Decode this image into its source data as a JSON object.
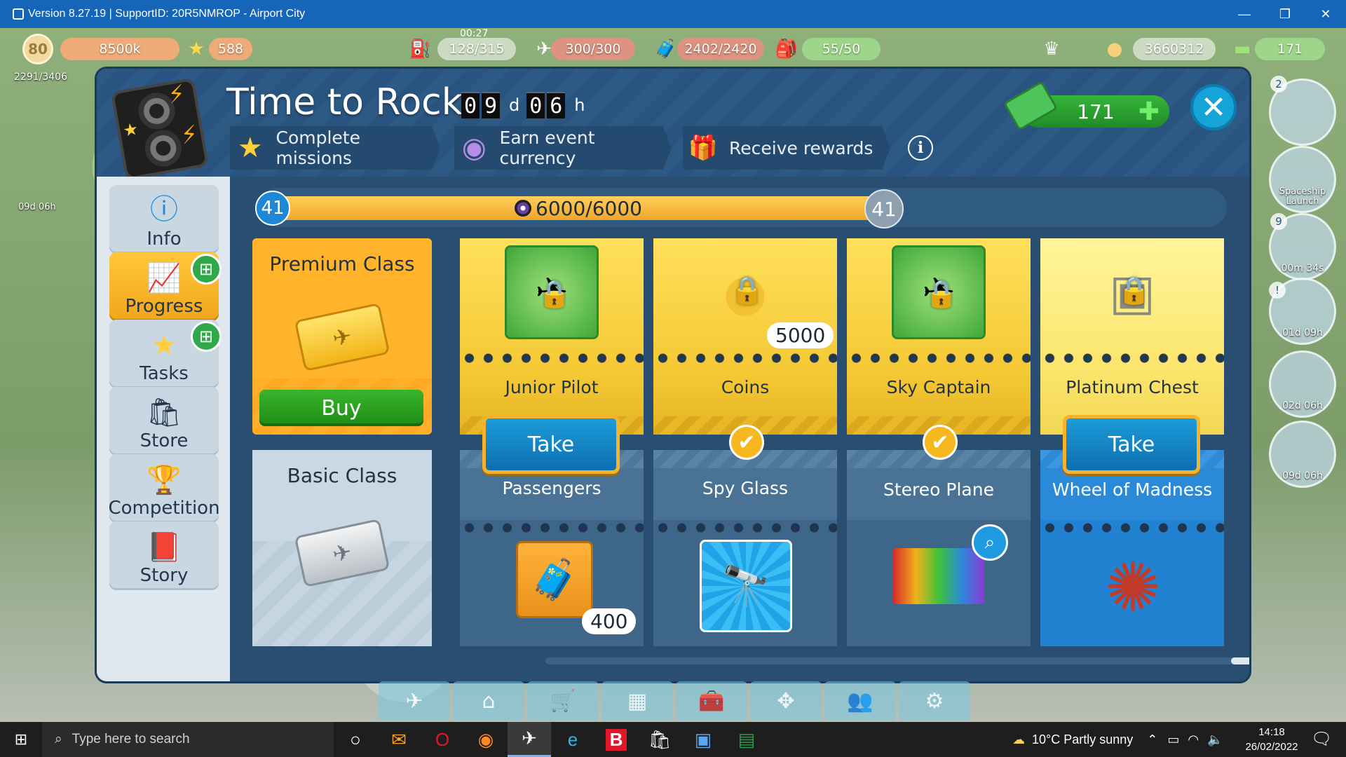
{
  "window": {
    "title": "Version 8.27.19 | SupportID: 20R5NMROP - Airport City",
    "minimize": "—",
    "restore": "❐",
    "close": "✕"
  },
  "hud": {
    "level": "80",
    "xp": "8500k",
    "stars": "588",
    "timer": "00:27",
    "fuel": "128/315",
    "cargo": "300/300",
    "passengers_cap": "2402/2420",
    "staff": "55/50",
    "coins": "3660312",
    "cash": "171",
    "population": "2291/3406",
    "side_timer": "09d 06h"
  },
  "event": {
    "title": "Time to Rock",
    "days_digits": [
      "0",
      "9"
    ],
    "days_unit": "d",
    "hours_digits": [
      "0",
      "6"
    ],
    "hours_unit": "h",
    "steps": [
      {
        "label": "Complete missions",
        "icon": "★"
      },
      {
        "label": "Earn event currency",
        "icon": "◉"
      },
      {
        "label": "Receive rewards",
        "icon": "🎁"
      }
    ],
    "info": "i",
    "currency_amount": "171",
    "currency_plus": "✚",
    "close": "✕"
  },
  "sidebar": {
    "items": [
      {
        "label": "Info",
        "icon": "ⓘ"
      },
      {
        "label": "Progress",
        "icon": "📈"
      },
      {
        "label": "Tasks",
        "icon": "★"
      },
      {
        "label": "Store",
        "icon": "🛍"
      },
      {
        "label": "Competition",
        "icon": "🏆"
      },
      {
        "label": "Story",
        "icon": "📕"
      }
    ]
  },
  "progress": {
    "level_left": "41",
    "level_right": "41",
    "text": "6000/6000",
    "fraction": 1.0
  },
  "premium": {
    "title": "Premium Class",
    "buy": "Buy"
  },
  "basic": {
    "title": "Basic Class"
  },
  "rewards": [
    {
      "premium_label": "Junior Pilot",
      "premium_qty": "",
      "basic_label": "Passengers",
      "basic_qty": "400",
      "state": "Take"
    },
    {
      "premium_label": "Coins",
      "premium_qty": "5000",
      "basic_label": "Spy Glass",
      "basic_qty": "",
      "state": "✔"
    },
    {
      "premium_label": "Sky Captain",
      "premium_qty": "",
      "basic_label": "Stereo Plane",
      "basic_qty": "",
      "state": "✔"
    },
    {
      "premium_label": "Platinum Chest",
      "premium_qty": "",
      "basic_label": "Wheel of Madness",
      "basic_qty": "",
      "state": "Take"
    }
  ],
  "right_hud": [
    {
      "label": "",
      "num": "2"
    },
    {
      "label": "Spaceship Launch",
      "num": ""
    },
    {
      "label": "00m 34s",
      "num": "9"
    },
    {
      "label": "01d 09h",
      "num": "!"
    },
    {
      "label": "02d 06h",
      "num": ""
    },
    {
      "label": "09d 06h",
      "num": ""
    }
  ],
  "taskbar": {
    "search_placeholder": "Type here to search",
    "weather": "10°C  Partly sunny",
    "time": "14:18",
    "date": "26/02/2022"
  },
  "colors": {
    "panel": "#2a4e72",
    "accent_gold": "#f4c833",
    "accent_blue": "#1d9bd9",
    "buy_green": "#2fa826"
  }
}
